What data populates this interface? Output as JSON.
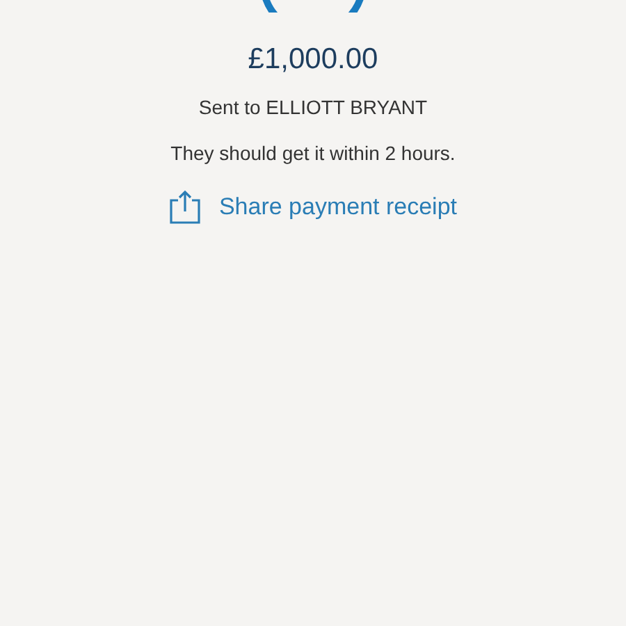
{
  "amount": "£1,000.00",
  "recipient_line": "Sent to ELLIOTT BRYANT",
  "eta": "They should get it within 2 hours.",
  "share_link": {
    "label": "Share payment receipt"
  }
}
